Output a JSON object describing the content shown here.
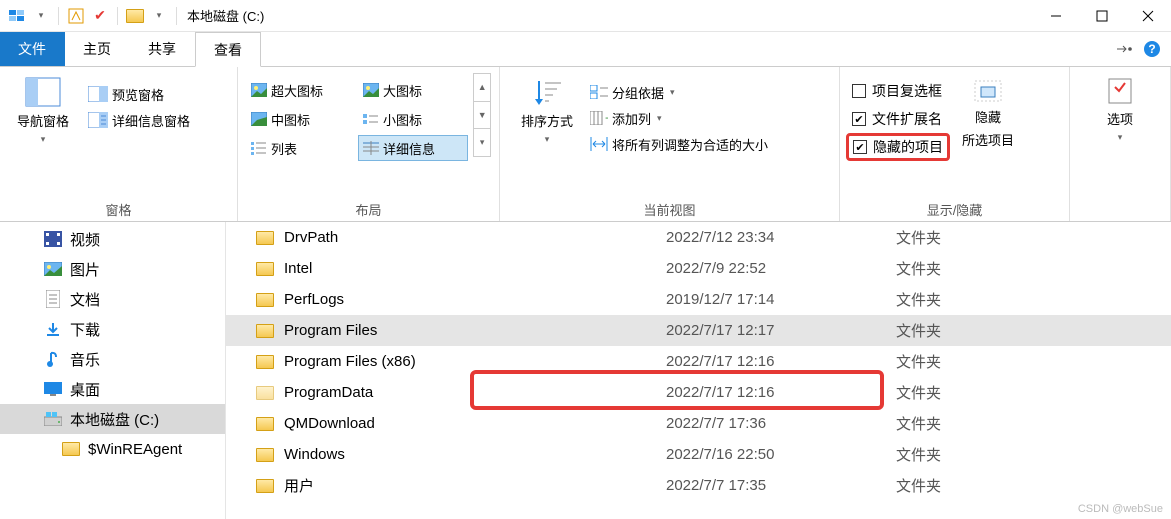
{
  "titlebar": {
    "title": "本地磁盘 (C:)"
  },
  "tabs": {
    "file": "文件",
    "home": "主页",
    "share": "共享",
    "view": "查看"
  },
  "ribbon": {
    "panes": {
      "nav": "导航窗格",
      "preview": "预览窗格",
      "details": "详细信息窗格",
      "group": "窗格"
    },
    "layout": {
      "xl": "超大图标",
      "large": "大图标",
      "medium": "中图标",
      "small": "小图标",
      "list": "列表",
      "details": "详细信息",
      "group": "布局"
    },
    "view": {
      "sort": "排序方式",
      "groupby": "分组依据",
      "addcol": "添加列",
      "autosize": "将所有列调整为合适的大小",
      "group": "当前视图"
    },
    "showhide": {
      "checkboxes": "项目复选框",
      "ext": "文件扩展名",
      "hidden": "隐藏的项目",
      "hide_btn": "隐藏",
      "hide_btn2": "所选项目",
      "group": "显示/隐藏"
    },
    "options": "选项"
  },
  "tree": {
    "items": [
      {
        "label": "视频",
        "icon": "video"
      },
      {
        "label": "图片",
        "icon": "picture"
      },
      {
        "label": "文档",
        "icon": "document"
      },
      {
        "label": "下载",
        "icon": "download"
      },
      {
        "label": "音乐",
        "icon": "music"
      },
      {
        "label": "桌面",
        "icon": "desktop"
      },
      {
        "label": "本地磁盘 (C:)",
        "icon": "drive",
        "selected": true
      },
      {
        "label": "$WinREAgent",
        "icon": "folder",
        "indent": true
      }
    ]
  },
  "files": {
    "rows": [
      {
        "name": "DrvPath",
        "date": "2022/7/12 23:34",
        "type": "文件夹"
      },
      {
        "name": "Intel",
        "date": "2022/7/9 22:52",
        "type": "文件夹"
      },
      {
        "name": "PerfLogs",
        "date": "2019/12/7 17:14",
        "type": "文件夹"
      },
      {
        "name": "Program Files",
        "date": "2022/7/17 12:17",
        "type": "文件夹",
        "selected": true
      },
      {
        "name": "Program Files (x86)",
        "date": "2022/7/17 12:16",
        "type": "文件夹"
      },
      {
        "name": "ProgramData",
        "date": "2022/7/17 12:16",
        "type": "文件夹",
        "highlight": true,
        "faded": true
      },
      {
        "name": "QMDownload",
        "date": "2022/7/7 17:36",
        "type": "文件夹"
      },
      {
        "name": "Windows",
        "date": "2022/7/16 22:50",
        "type": "文件夹"
      },
      {
        "name": "用户",
        "date": "2022/7/7 17:35",
        "type": "文件夹"
      }
    ]
  },
  "watermark": "CSDN @webSue"
}
